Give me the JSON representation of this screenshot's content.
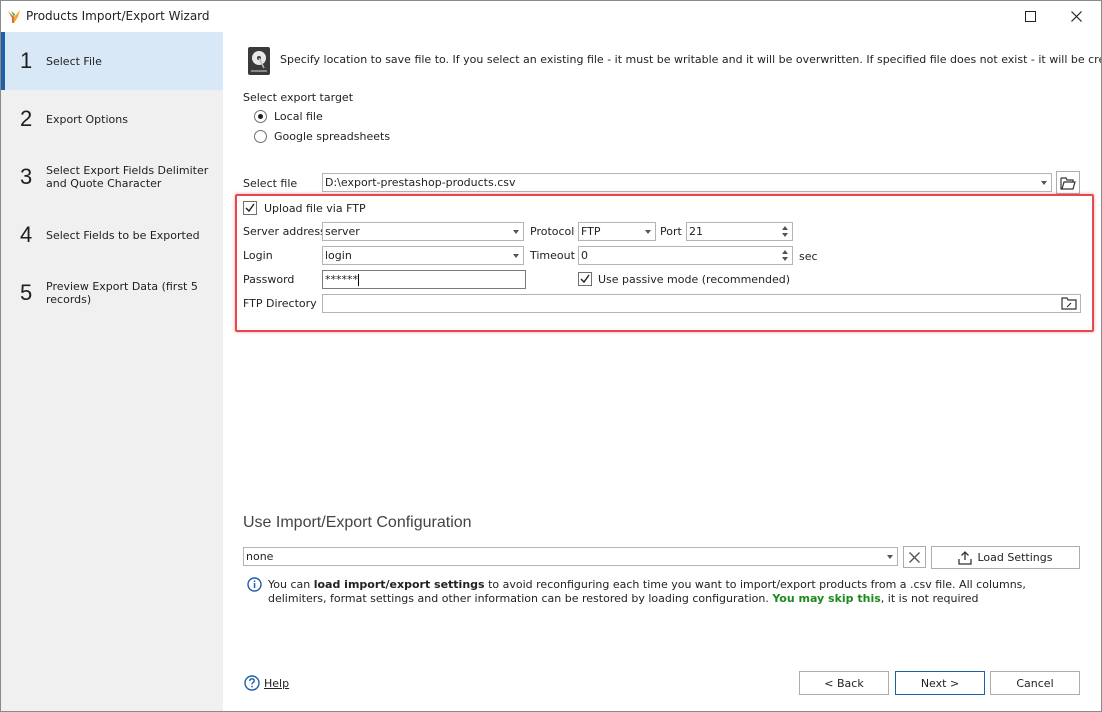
{
  "window": {
    "title": "Products Import/Export Wizard"
  },
  "steps": [
    {
      "num": "1",
      "label": "Select File",
      "active": true
    },
    {
      "num": "2",
      "label": "Export Options",
      "active": false
    },
    {
      "num": "3",
      "label": "Select Export Fields Delimiter and Quote Character",
      "active": false
    },
    {
      "num": "4",
      "label": "Select Fields to be Exported",
      "active": false
    },
    {
      "num": "5",
      "label": "Preview Export Data (first 5 records)",
      "active": false
    }
  ],
  "intro_text": "Specify location to save file to. If you select an existing file - it must be writable and it will be overwritten. If specified file does not exist - it will be created.",
  "export_target": {
    "label": "Select export target",
    "options": [
      "Local file",
      "Google spreadsheets"
    ],
    "selected": "Local file"
  },
  "select_file": {
    "label": "Select file",
    "value": "D:\\export-prestashop-products.csv"
  },
  "ftp": {
    "upload_label": "Upload file via FTP",
    "upload_checked": true,
    "server_label": "Server address",
    "server_value": "server",
    "protocol_label": "Protocol",
    "protocol_value": "FTP",
    "port_label": "Port",
    "port_value": "21",
    "login_label": "Login",
    "login_value": "login",
    "timeout_label": "Timeout",
    "timeout_value": "0",
    "timeout_unit": "sec",
    "password_label": "Password",
    "password_value": "******",
    "passive_label": "Use passive mode (recommended)",
    "passive_checked": true,
    "directory_label": "FTP Directory",
    "directory_value": ""
  },
  "config": {
    "title": "Use Import/Export Configuration",
    "value": "none",
    "load_label": "Load Settings",
    "info_part1": "You can ",
    "info_bold": "load import/export settings",
    "info_part2": " to avoid reconfiguring each time you want to import/export products from a .csv file. All columns, delimiters, format settings and other information can be restored by loading configuration. ",
    "info_green": "You may skip this",
    "info_part3": ", it is not required"
  },
  "footer": {
    "help": "Help",
    "back": "< Back",
    "next": "Next >",
    "cancel": "Cancel"
  },
  "colors": {
    "accent": "#1f5ea8",
    "highlight": "#e8484d",
    "green": "#1d8a1d",
    "active_step": "#d9e8f6"
  }
}
